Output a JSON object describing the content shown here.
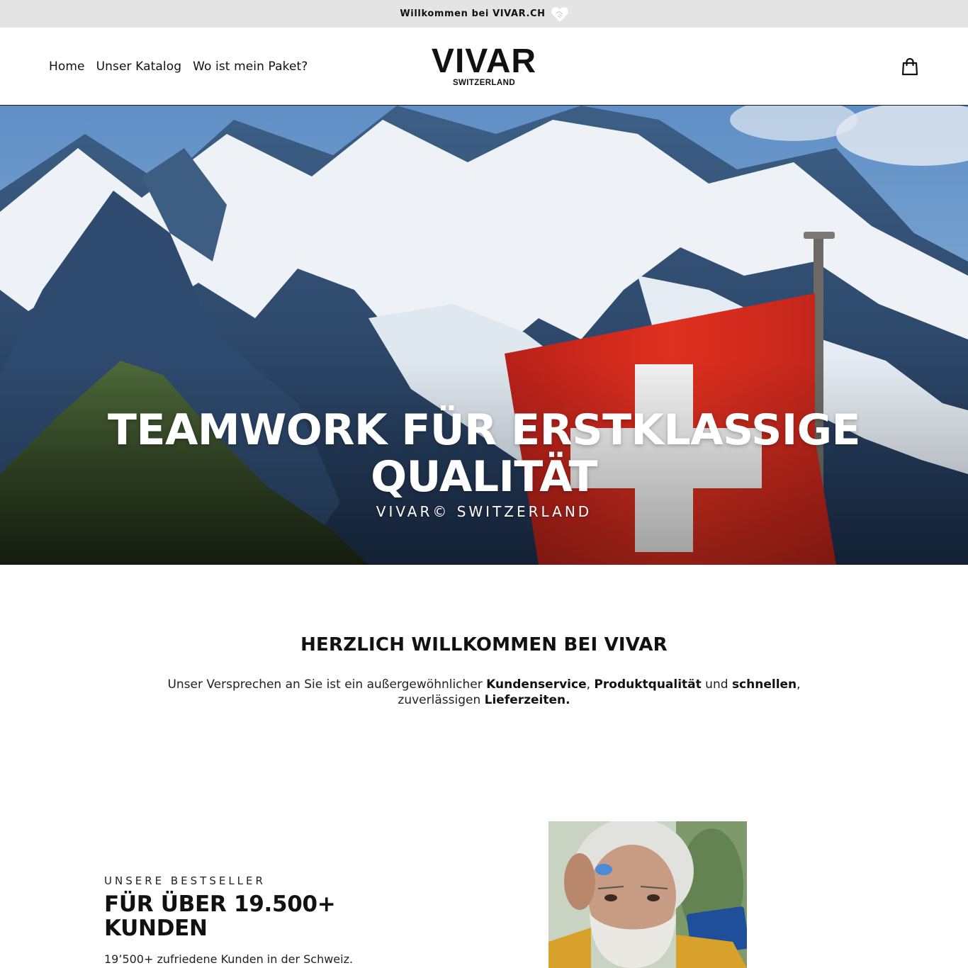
{
  "announcement": {
    "text": "Willkommen bei VIVAR.CH",
    "icon": "heart-handshake-icon"
  },
  "header": {
    "nav": [
      {
        "label": "Home"
      },
      {
        "label": "Unser Katalog"
      },
      {
        "label": "Wo ist mein Paket?"
      }
    ],
    "logo": {
      "main": "VIVAR",
      "sub": "SWITZERLAND"
    },
    "cart_icon": "shopping-bag-icon"
  },
  "hero": {
    "title": "TEAMWORK FÜR ERSTKLASSIGE QUALITÄT",
    "subtitle": "VIVAR© SWITZERLAND"
  },
  "welcome": {
    "title": "HERZLICH WILLKOMMEN BEI VIVAR",
    "text_parts": {
      "p1": "Unser Versprechen an Sie ist ein außergewöhnlicher ",
      "b1": "Kundenservice",
      "p2": ", ",
      "b2": "Produktqualität",
      "p3": " und ",
      "b3": "schnellen",
      "p4": ", zuverlässigen ",
      "b4": "Lieferzeiten."
    }
  },
  "bestseller": {
    "kicker": "UNSERE BESTSELLER",
    "title": "FÜR ÜBER 19.500+ KUNDEN",
    "text": "19’500+ zufriedene Kunden in der Schweiz."
  },
  "colors": {
    "announcement_bg": "#e4e4e4",
    "flag_red": "#d52b1e",
    "text": "#111111"
  }
}
